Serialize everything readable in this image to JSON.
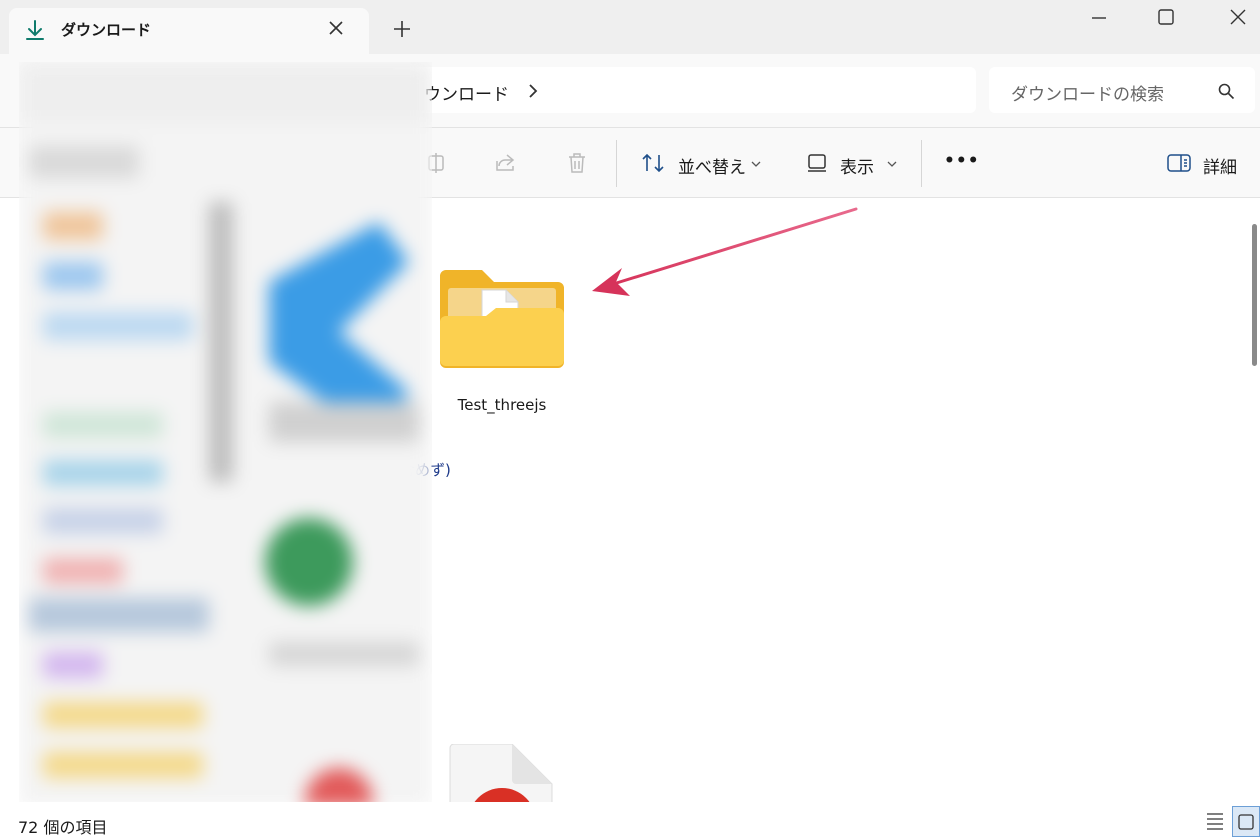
{
  "tab": {
    "title": "ダウンロード",
    "add_label": "+"
  },
  "address": {
    "crumb": "ウンロード",
    "chevron": "›"
  },
  "search": {
    "placeholder": "ダウンロードの検索"
  },
  "toolbar": {
    "sort_label": "並べ替え",
    "view_label": "表示",
    "more_label": "•••",
    "details_label": "詳細"
  },
  "content": {
    "folder_name": "Test_threejs",
    "partial_text": "含めず)"
  },
  "status": {
    "item_count": "72 個の項目"
  },
  "icons": {
    "tab": "download-icon",
    "close": "close-icon",
    "minimize": "minimize-icon",
    "maximize": "maximize-icon",
    "window_close": "window-close-icon",
    "search": "search-icon",
    "rename": "rename-icon",
    "share": "share-icon",
    "delete": "trash-icon",
    "sort": "sort-icon",
    "view": "view-icon",
    "details": "details-pane-icon",
    "list_view": "list-view-icon",
    "grid_view": "grid-view-icon",
    "folder": "folder-icon",
    "pdf": "pdf-file-icon"
  },
  "colors": {
    "accent": "#0f7b6c",
    "annotation_arrow": "#e0436f",
    "folder_yellow": "#f6c453",
    "link_blue": "#1e3a8a"
  }
}
